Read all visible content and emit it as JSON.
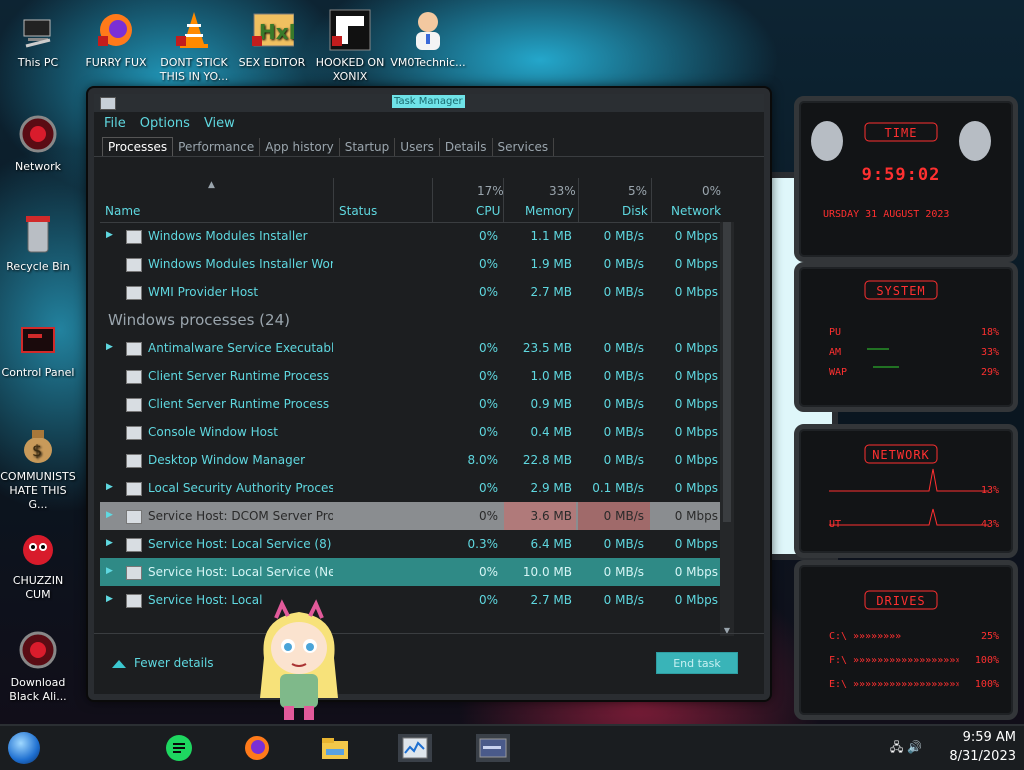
{
  "desktop": {
    "icons": [
      {
        "label": "This PC"
      },
      {
        "label": "FURRY FUX"
      },
      {
        "label": "DONT STICK THIS IN YO..."
      },
      {
        "label": "SEX EDITOR"
      },
      {
        "label": "HOOKED ON XONIX"
      },
      {
        "label": "VM0Technic..."
      },
      {
        "label": "Network"
      },
      {
        "label": "Recycle Bin"
      },
      {
        "label": "Control Panel"
      },
      {
        "label": "COMMUNISTS HATE THIS G..."
      },
      {
        "label": "CHUZZIN CUM"
      },
      {
        "label": "Download Black Ali..."
      }
    ]
  },
  "window": {
    "title": "Task Manager",
    "menu": [
      "File",
      "Options",
      "View"
    ],
    "tabs": [
      "Processes",
      "Performance",
      "App history",
      "Startup",
      "Users",
      "Details",
      "Services"
    ],
    "columns": {
      "name": "Name",
      "status": "Status",
      "cpu": "CPU",
      "cpu_pct": "17%",
      "memory": "Memory",
      "memory_pct": "33%",
      "disk": "Disk",
      "disk_pct": "5%",
      "network": "Network",
      "network_pct": "0%"
    },
    "rows": [
      {
        "type": "proc",
        "expand": true,
        "name": "Windows Modules Installer",
        "cpu": "0%",
        "mem": "1.1 MB",
        "disk": "0 MB/s",
        "net": "0 Mbps"
      },
      {
        "type": "proc",
        "expand": false,
        "name": "Windows Modules Installer Wor...",
        "cpu": "0%",
        "mem": "1.9 MB",
        "disk": "0 MB/s",
        "net": "0 Mbps"
      },
      {
        "type": "proc",
        "expand": false,
        "name": "WMI Provider Host",
        "cpu": "0%",
        "mem": "2.7 MB",
        "disk": "0 MB/s",
        "net": "0 Mbps"
      },
      {
        "type": "group",
        "name": "Windows processes (24)"
      },
      {
        "type": "proc",
        "expand": true,
        "name": "Antimalware Service Executable",
        "cpu": "0%",
        "mem": "23.5 MB",
        "disk": "0 MB/s",
        "net": "0 Mbps"
      },
      {
        "type": "proc",
        "expand": false,
        "name": "Client Server Runtime Process",
        "cpu": "0%",
        "mem": "1.0 MB",
        "disk": "0 MB/s",
        "net": "0 Mbps"
      },
      {
        "type": "proc",
        "expand": false,
        "name": "Client Server Runtime Process",
        "cpu": "0%",
        "mem": "0.9 MB",
        "disk": "0 MB/s",
        "net": "0 Mbps"
      },
      {
        "type": "proc",
        "expand": false,
        "name": "Console Window Host",
        "cpu": "0%",
        "mem": "0.4 MB",
        "disk": "0 MB/s",
        "net": "0 Mbps"
      },
      {
        "type": "proc",
        "expand": false,
        "name": "Desktop Window Manager",
        "cpu": "8.0%",
        "mem": "22.8 MB",
        "disk": "0 MB/s",
        "net": "0 Mbps"
      },
      {
        "type": "proc",
        "expand": true,
        "name": "Local Security Authority Process",
        "cpu": "0%",
        "mem": "2.9 MB",
        "disk": "0.1 MB/s",
        "net": "0 Mbps"
      },
      {
        "type": "proc",
        "expand": true,
        "highlight": "gray",
        "name": "Service Host: DCOM Server Proc...",
        "cpu": "0%",
        "mem": "3.6 MB",
        "disk": "0 MB/s",
        "net": "0 Mbps"
      },
      {
        "type": "proc",
        "expand": true,
        "name": "Service Host: Local Service (8)",
        "cpu": "0.3%",
        "mem": "6.4 MB",
        "disk": "0 MB/s",
        "net": "0 Mbps"
      },
      {
        "type": "proc",
        "expand": true,
        "highlight": "teal",
        "name": "Service Host: Local Service (Net...",
        "cpu": "0%",
        "mem": "10.0 MB",
        "disk": "0 MB/s",
        "net": "0 Mbps"
      },
      {
        "type": "proc",
        "expand": true,
        "name": "Service Host: Local",
        "cpu": "0%",
        "mem": "2.7 MB",
        "disk": "0 MB/s",
        "net": "0 Mbps"
      }
    ],
    "footer": {
      "fewer_details": "Fewer details",
      "end_task": "End task"
    }
  },
  "widgets": {
    "time": {
      "header": "TIME",
      "clock": "9:59:02",
      "date": "URSDAY 31 AUGUST 2023"
    },
    "system": {
      "header": "SYSTEM",
      "rows": [
        {
          "label": "PU",
          "value": "18%"
        },
        {
          "label": "AM",
          "value": "33%"
        },
        {
          "label": "WAP",
          "value": "29%"
        }
      ]
    },
    "network": {
      "header": "NETWORK",
      "rows": [
        {
          "label": "",
          "value": "13%"
        },
        {
          "label": "UT",
          "value": "43%"
        }
      ]
    },
    "drives": {
      "header": "DRIVES",
      "rows": [
        {
          "label": "C:\\",
          "bar": "»»»»»»»»",
          "value": "25%"
        },
        {
          "label": "F:\\",
          "bar": "»»»»»»»»»»»»»»»»»»»»»»",
          "value": "100%"
        },
        {
          "label": "E:\\",
          "bar": "»»»»»»»»»»»»»»»»»»»»»»",
          "value": "100%"
        }
      ]
    }
  },
  "taskbar": {
    "time": "9:59 AM",
    "date": "8/31/2023"
  },
  "colors": {
    "accent": "#5fd8e0",
    "widget_text": "#ff3030",
    "end_task_bg": "#39b4b8"
  }
}
